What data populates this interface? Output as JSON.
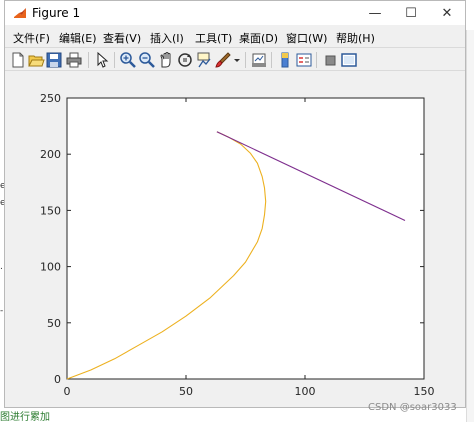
{
  "window": {
    "title": "Figure 1",
    "controls": {
      "minimize": "—",
      "maximize": "☐",
      "close": "✕"
    }
  },
  "menu": [
    {
      "label": "文件(F)"
    },
    {
      "label": "编辑(E)"
    },
    {
      "label": "查看(V)"
    },
    {
      "label": "插入(I)"
    },
    {
      "label": "工具(T)"
    },
    {
      "label": "桌面(D)"
    },
    {
      "label": "窗口(W)"
    },
    {
      "label": "帮助(H)"
    }
  ],
  "toolbar": {
    "icons": [
      "new-figure-icon",
      "open-file-icon",
      "save-icon",
      "print-icon",
      "pointer-icon",
      "zoom-in-icon",
      "zoom-out-icon",
      "pan-icon",
      "rotate-3d-icon",
      "data-cursor-icon",
      "brush-icon",
      "link-plot-icon",
      "colorbar-icon",
      "legend-icon",
      "hide-plot-tools-icon",
      "show-plot-tools-icon"
    ]
  },
  "background": {
    "left_glyphs": [
      "e",
      "e",
      ".",
      "-"
    ],
    "bottom_text": "图进行累加"
  },
  "watermark": "CSDN @soar3033",
  "chart_data": {
    "type": "line",
    "title": "",
    "xlabel": "",
    "ylabel": "",
    "xlim": [
      0,
      150
    ],
    "ylim": [
      0,
      250
    ],
    "xticks": [
      0,
      50,
      100,
      150
    ],
    "yticks": [
      0,
      50,
      100,
      150,
      200,
      250
    ],
    "grid": false,
    "series": [
      {
        "color": "#EDB120",
        "x": [
          0,
          10,
          20,
          30,
          40,
          50,
          60,
          70,
          75,
          80,
          82,
          83,
          83.5,
          83,
          82,
          80,
          77,
          73,
          68,
          63
        ],
        "y": [
          0,
          8,
          18,
          30,
          42,
          56,
          72,
          92,
          104,
          122,
          134,
          146,
          158,
          170,
          180,
          192,
          201,
          209,
          215,
          220
        ]
      },
      {
        "color": "#7E2F8E",
        "x": [
          63,
          142
        ],
        "y": [
          220,
          141
        ]
      }
    ]
  }
}
